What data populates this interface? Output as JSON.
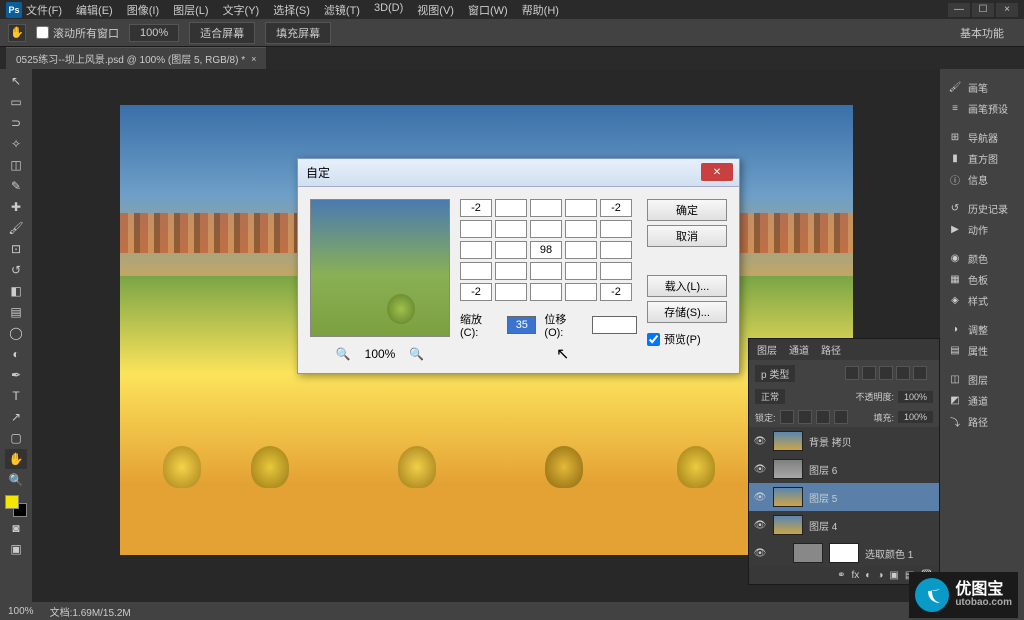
{
  "app": {
    "logo": "Ps"
  },
  "menu": [
    "文件(F)",
    "编辑(E)",
    "图像(I)",
    "图层(L)",
    "文字(Y)",
    "选择(S)",
    "滤镜(T)",
    "3D(D)",
    "视图(V)",
    "窗口(W)",
    "帮助(H)"
  ],
  "options": {
    "scroll_all": "滚动所有窗口",
    "zoom": "100%",
    "fit": "适合屏幕",
    "fill": "填充屏幕"
  },
  "workspace": "基本功能",
  "doctab": {
    "title": "0525练习--坝上风景.psd @ 100% (图层 5, RGB/8) *"
  },
  "right_rail": [
    "画笔",
    "画笔预设",
    "导航器",
    "直方图",
    "信息",
    "历史记录",
    "动作",
    "颜色",
    "色板",
    "样式",
    "调整",
    "属性",
    "图层",
    "通道",
    "路径"
  ],
  "layers": {
    "tabs": [
      "图层",
      "通道",
      "路径"
    ],
    "kind": "p 类型",
    "opacity_label": "不透明度:",
    "opacity": "100%",
    "lock_label": "锁定:",
    "fill_label": "填充:",
    "fill": "100%",
    "normal": "正常",
    "items": [
      {
        "name": "背景 拷贝",
        "sel": false
      },
      {
        "name": "图层 6",
        "sel": false,
        "bw": true
      },
      {
        "name": "图层 5",
        "sel": true
      },
      {
        "name": "图层 4",
        "sel": false
      },
      {
        "name": "选取颜色 1",
        "sel": false,
        "adj": true
      }
    ]
  },
  "dialog": {
    "title": "自定",
    "ok": "确定",
    "cancel": "取消",
    "load": "载入(L)...",
    "save": "存储(S)...",
    "preview_label": "预览(P)",
    "zoom": "100%",
    "scale_label": "缩放(C):",
    "scale_value": "35",
    "offset_label": "位移(O):",
    "offset_value": "",
    "matrix": [
      [
        "-2",
        "",
        "",
        "",
        "-2"
      ],
      [
        "",
        "",
        "",
        "",
        ""
      ],
      [
        "",
        "",
        "98",
        "",
        ""
      ],
      [
        "",
        "",
        "",
        "",
        ""
      ],
      [
        "-2",
        "",
        "",
        "",
        "-2"
      ]
    ]
  },
  "status": {
    "zoom": "100%",
    "doc": "文档:1.69M/15.2M"
  },
  "watermark": {
    "name": "优图宝",
    "url": "utobao.com"
  }
}
